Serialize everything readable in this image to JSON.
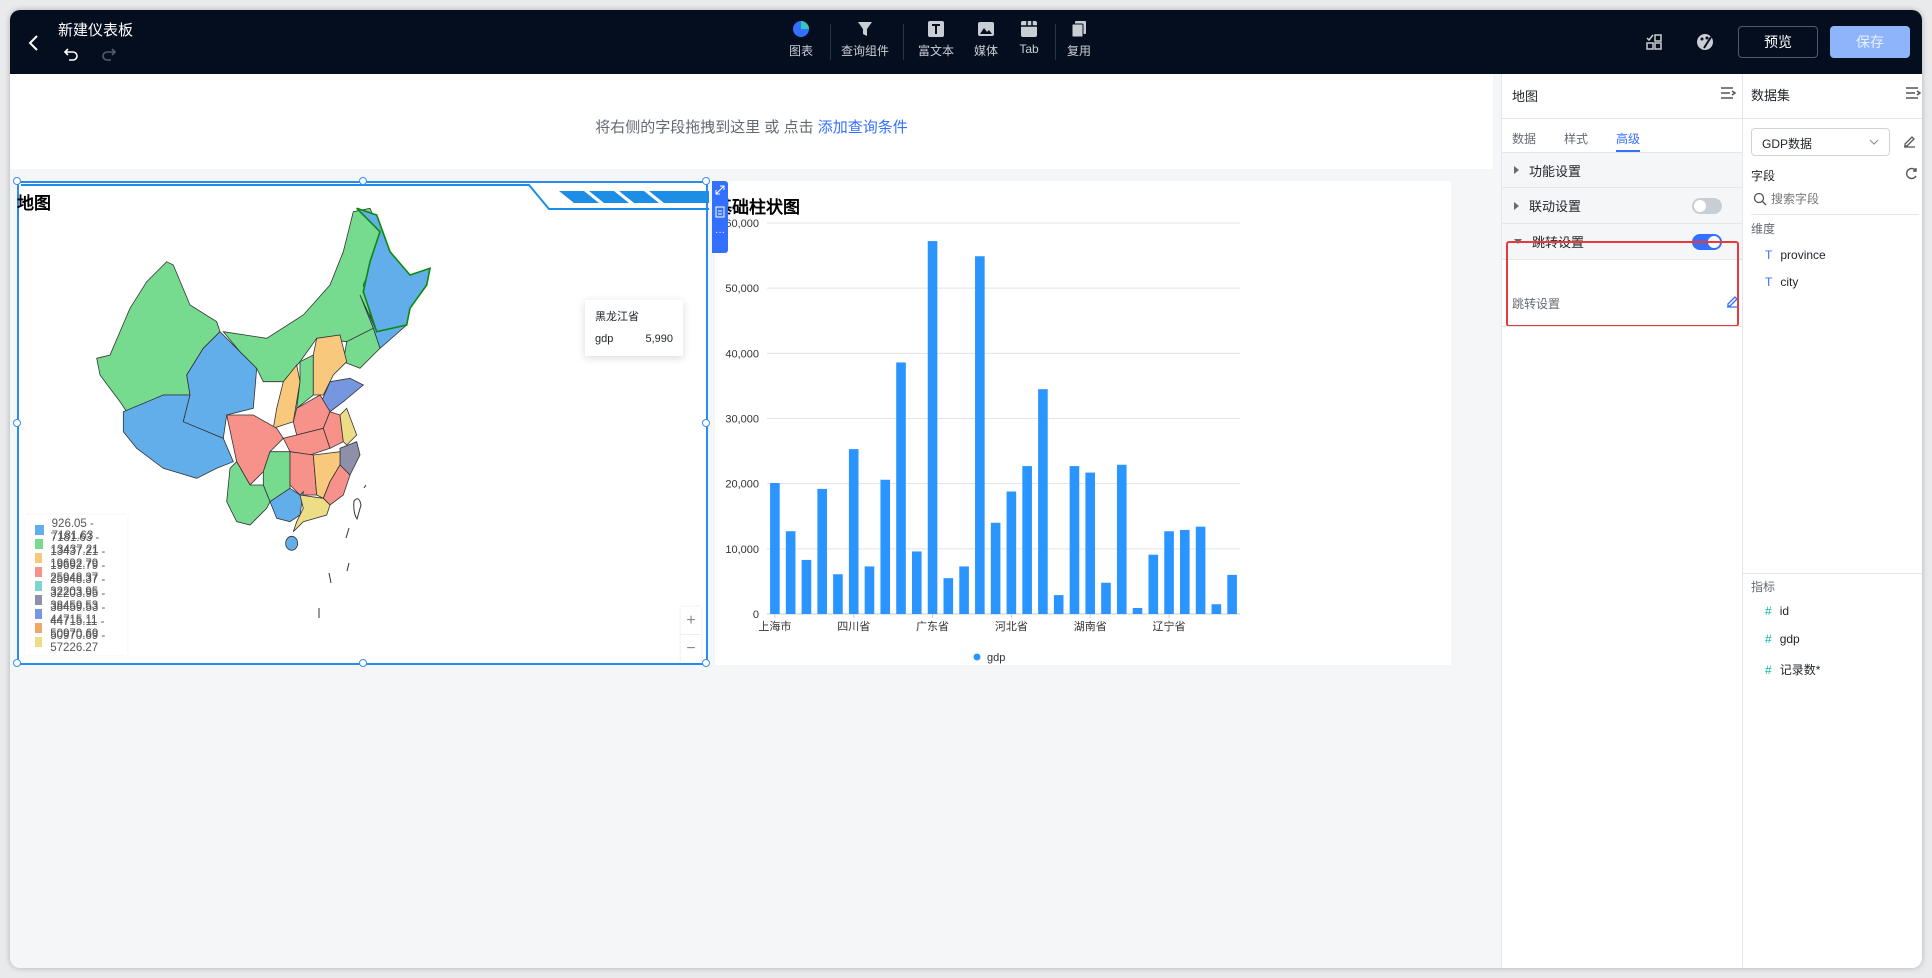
{
  "header": {
    "title": "新建仪表板",
    "tools": [
      {
        "icon": "chart-pie-icon",
        "label": "图表"
      },
      {
        "icon": "filter-icon",
        "label": "查询组件"
      },
      {
        "icon": "rich-text-icon",
        "label": "富文本"
      },
      {
        "icon": "media-image-icon",
        "label": "媒体"
      },
      {
        "icon": "tab-icon",
        "label": "Tab"
      },
      {
        "icon": "copy-reuse-icon",
        "label": "复用"
      }
    ],
    "preview": "预览",
    "save": "保存"
  },
  "query": {
    "hint": "将右侧的字段拖拽到这里 或 点击",
    "link": "添加查询条件"
  },
  "map_card": {
    "title": "地图",
    "tooltip": {
      "name": "黑龙江省",
      "key": "gdp",
      "value": "5,990"
    },
    "legend": [
      {
        "label": "926.05 - 7181.63",
        "color": "#62aeea"
      },
      {
        "label": "7181.63 - 13437.21",
        "color": "#76da8f"
      },
      {
        "label": "13437.21 - 19692.79",
        "color": "#f8c97c"
      },
      {
        "label": "19692.79 - 25948.37",
        "color": "#f6928a"
      },
      {
        "label": "25948.37 - 32203.95",
        "color": "#7ad6cf"
      },
      {
        "label": "32203.95 - 38459.53",
        "color": "#8d90a8"
      },
      {
        "label": "38459.53 - 44715.11",
        "color": "#7696e0"
      },
      {
        "label": "44715.11 - 50970.69",
        "color": "#f0a569"
      },
      {
        "label": "50970.69 - 57226.27",
        "color": "#ecdd86"
      }
    ],
    "zoom_in": "+",
    "zoom_out": "−"
  },
  "chart_data": {
    "type": "bar",
    "title": "基础柱状图",
    "categories": [
      "上海市",
      "",
      "",
      "",
      "",
      "四川省",
      "",
      "",
      "",
      "",
      "广东省",
      "",
      "",
      "",
      "",
      "河北省",
      "",
      "",
      "",
      "",
      "湖南省",
      "",
      "",
      "",
      "",
      "辽宁省",
      "",
      "",
      "",
      ""
    ],
    "series": [
      {
        "name": "gdp",
        "color": "#2b95ff",
        "values": [
          20100,
          12700,
          8300,
          19200,
          6100,
          25300,
          7300,
          20600,
          38600,
          9600,
          57226,
          5500,
          7300,
          54900,
          14000,
          18800,
          22700,
          34500,
          2900,
          22700,
          21700,
          4800,
          22900,
          926,
          9100,
          12700,
          12900,
          13400,
          1500,
          6000
        ]
      }
    ],
    "ylim": [
      0,
      60000
    ],
    "yticks": [
      "0",
      "10,000",
      "20,000",
      "30,000",
      "40,000",
      "50,000",
      "60,000"
    ],
    "grid": true,
    "legend": "bottom"
  },
  "config_panel": {
    "title": "地图",
    "tabs": [
      "数据",
      "样式",
      "高级"
    ],
    "active_tab": 2,
    "sections": [
      {
        "label": "功能设置"
      },
      {
        "label": "联动设置",
        "toggle": false
      },
      {
        "label": "跳转设置",
        "toggle": true
      }
    ],
    "jump_label": "跳转设置",
    "accent": "#3370ff",
    "highlight": "#e8393d"
  },
  "dataset_panel": {
    "title": "数据集",
    "dataset": "GDP数据",
    "fields_label": "字段",
    "search_placeholder": "搜索字段",
    "dim_label": "维度",
    "dimensions": [
      "province",
      "city"
    ],
    "metric_label": "指标",
    "metrics": [
      "id",
      "gdp",
      "记录数*"
    ]
  }
}
